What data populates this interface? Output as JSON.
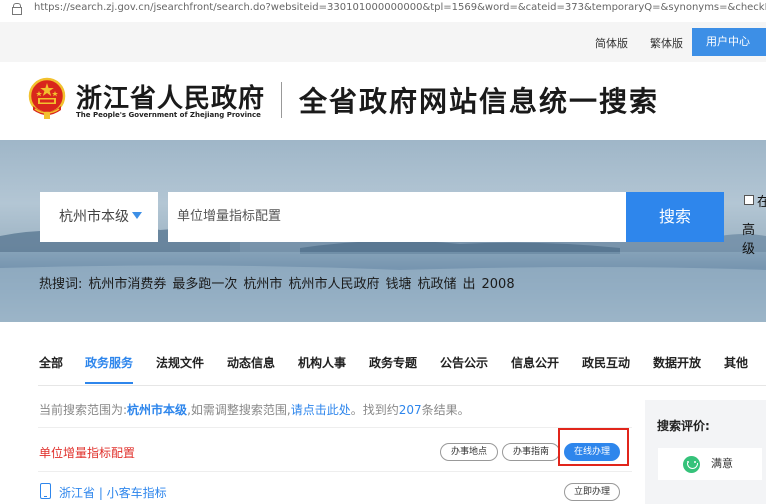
{
  "browser": {
    "url": "https://search.zj.gov.cn/jsearchfront/search.do?websiteid=330101000000000&tpl=1569&word=&cateid=373&temporaryQ=&synonyms=&checkError=1&p"
  },
  "topbar": {
    "simplified": "简体版",
    "traditional": "繁体版",
    "user_center": "用户中心"
  },
  "header": {
    "site_name": "浙江省人民政府",
    "site_name_en": "The People's Government of Zhejiang Province",
    "search_title": "全省政府网站信息统一搜索"
  },
  "search": {
    "region": "杭州市本级",
    "query": "单位增量指标配置",
    "button": "搜索",
    "checkbox_label": "在",
    "advanced": "高级"
  },
  "hot": {
    "label": "热搜词:",
    "terms": [
      "杭州市消费券",
      "最多跑一次",
      "杭州市",
      "杭州市人民政府",
      "钱塘",
      "杭政储",
      "出",
      "2008"
    ]
  },
  "tabs": {
    "items": [
      "全部",
      "政务服务",
      "法规文件",
      "动态信息",
      "机构人事",
      "政务专题",
      "公告公示",
      "信息公开",
      "政民互动",
      "数据开放",
      "其他"
    ],
    "active": "政务服务"
  },
  "scope": {
    "prefix": "当前搜索范围为:",
    "region": "杭州市本级",
    "middle": ",如需调整搜索范围,",
    "link": "请点击此处",
    "found_prefix": "。找到约",
    "count": "207",
    "found_suffix": "条结果。"
  },
  "results": [
    {
      "title": "单位增量指标配置",
      "actions": [
        "办事地点",
        "办事指南",
        "在线办理"
      ]
    },
    {
      "title": "浙江省 | 小客车指标",
      "actions": [
        "立即办理"
      ]
    }
  ],
  "rating": {
    "title": "搜索评价:",
    "satisfied": "满意"
  },
  "colors": {
    "accent": "#2e86ec",
    "result_title": "#e0302b",
    "highlight_box": "#e1251b"
  }
}
